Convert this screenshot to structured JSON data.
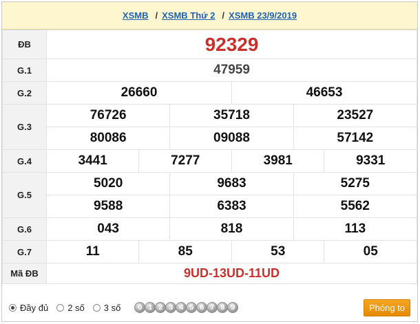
{
  "breadcrumb": {
    "items": [
      "XSMB",
      "XSMB Thứ 2",
      "XSMB 23/9/2019"
    ],
    "separator": "/"
  },
  "results": {
    "labels": {
      "special": "ĐB",
      "g1": "G.1",
      "g2": "G.2",
      "g3": "G.3",
      "g4": "G.4",
      "g5": "G.5",
      "g6": "G.6",
      "g7": "G.7",
      "madb": "Mã ĐB"
    },
    "special": "92329",
    "g1": "47959",
    "g2": [
      "26660",
      "46653"
    ],
    "g3": [
      "76726",
      "35718",
      "23527",
      "80086",
      "09088",
      "57142"
    ],
    "g4": [
      "3441",
      "7277",
      "3981",
      "9331"
    ],
    "g5": [
      "5020",
      "9683",
      "5275",
      "9588",
      "6383",
      "5562"
    ],
    "g6": [
      "043",
      "818",
      "113"
    ],
    "g7": [
      "11",
      "85",
      "53",
      "05"
    ],
    "madb": "9UD-13UD-11UD"
  },
  "footer": {
    "options": [
      "Đầy đủ",
      "2 số",
      "3 số"
    ],
    "selected": "Đầy đủ",
    "digits": [
      "0",
      "1",
      "2",
      "3",
      "4",
      "5",
      "6",
      "7",
      "8",
      "9"
    ],
    "zoom_label": "Phóng to"
  },
  "colors": {
    "accent_red": "#c9302c",
    "link_blue": "#1f62b5",
    "header_bg": "#fdf6cf",
    "button_orange": "#f0990f"
  }
}
